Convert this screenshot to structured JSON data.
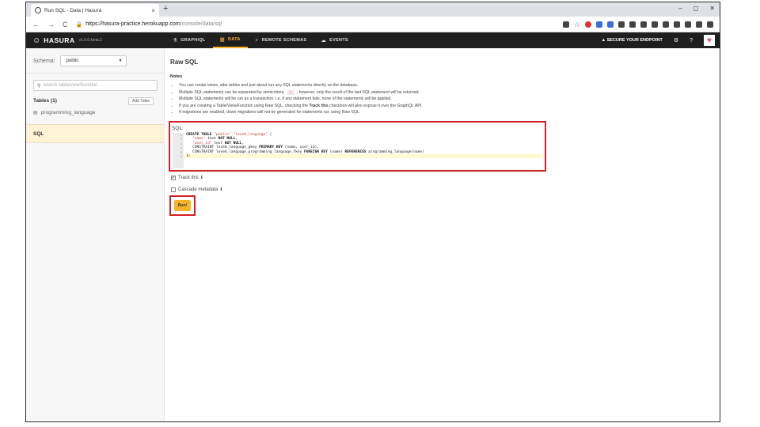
{
  "browser": {
    "tab_title": "Run SQL - Data | Hasura",
    "tab_close": "×",
    "new_tab": "+",
    "win_controls": [
      "–",
      "◻",
      "✕"
    ],
    "nav": [
      "←",
      "→",
      "C"
    ],
    "url_host": "https://hasura-practice.herokuapp.com",
    "url_path": "/console/data/sql",
    "lock_icon": "🔒",
    "star": "☆"
  },
  "header": {
    "brand": "HASURA",
    "version": "v1.0.0-beta.2",
    "tabs": [
      {
        "label": "GRAPHIQL",
        "icon": "⚗"
      },
      {
        "label": "DATA",
        "icon": "▦"
      },
      {
        "label": "REMOTE SCHEMAS",
        "icon": "⚡"
      },
      {
        "label": "EVENTS",
        "icon": "☁"
      }
    ],
    "secure": "▲ SECURE YOUR ENDPOINT",
    "gear": "⚙",
    "help": "?",
    "heart": "♥"
  },
  "sidebar": {
    "schema_label": "Schema:",
    "schema_value": "public",
    "search_placeholder": "search table/view/function",
    "tables_heading": "Tables (1)",
    "add_table": "Add Table",
    "table_items": [
      "programming_language"
    ],
    "sql_item": "SQL"
  },
  "main": {
    "title": "Raw SQL",
    "notes_title": "Notes",
    "notes": {
      "n1": "You can create views, alter tables and just about run any SQL statements directly on the database.",
      "n2a": "Multiple SQL statements can be separated by semicolons,",
      "n2_semi": ";",
      "n2b": ", however, only the result of the last SQL statement will be returned.",
      "n3": "Multiple SQL statements will be run as a transaction. i.e. if any statement fails, none of the statements will be applied.",
      "n4a": "If you are creating a Table/View/Function using Raw SQL, checking the",
      "n4_bold": "Track this",
      "n4b": "checkbox will also expose it over the GraphQL API.",
      "n5": "If migrations are enabled, down migrations will not be generated for statements run using Raw SQL."
    },
    "sql_label": "SQL:",
    "line_numbers": [
      "1",
      "2",
      "3",
      "4",
      "5",
      "6"
    ],
    "code": {
      "l1_kw": "CREATE TABLE",
      "l1_str": "\"public\".\"loved_language\"",
      "l1_end": " (",
      "l2_str": "\"name\"",
      "l2_txt": " text ",
      "l2_kw": "NOT NULL",
      "l2_end": ",",
      "l3_str": "\"user_id\"",
      "l3_txt": " text ",
      "l3_kw": "NOT NULL",
      "l3_end": ",",
      "l4_a": "CONSTRAINT loved_language_pkey ",
      "l4_kw": "PRIMARY KEY",
      "l4_b": " (name, user_id),",
      "l5_a": "CONSTRAINT loved_language_programming_language_fkey ",
      "l5_kw1": "FOREIGN KEY",
      "l5_b": " (name) ",
      "l5_kw2": "REFERENCES",
      "l5_c": " programming_language(name)",
      "l6": ");"
    },
    "track_this": "Track this",
    "cascade": "Cascade metadata",
    "info_icon": "ℹ",
    "check_mark": "✔",
    "run_label": "Run!"
  }
}
